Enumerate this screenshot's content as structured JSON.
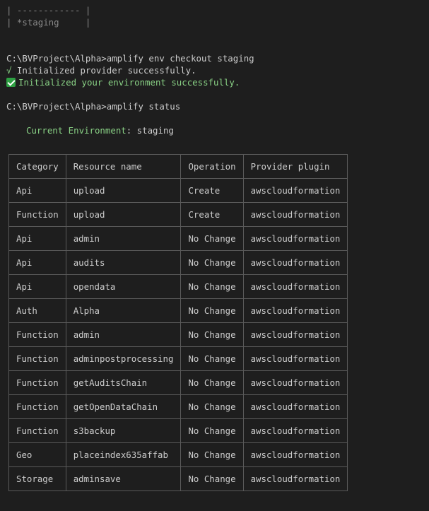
{
  "terminal": {
    "env_list_separator": "| ------------ |",
    "env_list_current": "| *staging     |",
    "command_checkout": "C:\\BVProject\\Alpha>amplify env checkout staging",
    "provider_check": "√",
    "provider_msg": " Initialized provider successfully.",
    "env_msg": "Initialized your environment successfully.",
    "command_status": "C:\\BVProject\\Alpha>amplify status",
    "current_env_label": "Current Environment",
    "current_env_value": ": staging"
  },
  "status_table": {
    "headers": [
      "Category",
      "Resource name",
      "Operation",
      "Provider plugin"
    ],
    "rows": [
      [
        "Api",
        "upload",
        "Create",
        "awscloudformation"
      ],
      [
        "Function",
        "upload",
        "Create",
        "awscloudformation"
      ],
      [
        "Api",
        "admin",
        "No Change",
        "awscloudformation"
      ],
      [
        "Api",
        "audits",
        "No Change",
        "awscloudformation"
      ],
      [
        "Api",
        "opendata",
        "No Change",
        "awscloudformation"
      ],
      [
        "Auth",
        "Alpha",
        "No Change",
        "awscloudformation"
      ],
      [
        "Function",
        "admin",
        "No Change",
        "awscloudformation"
      ],
      [
        "Function",
        "adminpostprocessing",
        "No Change",
        "awscloudformation"
      ],
      [
        "Function",
        "getAuditsChain",
        "No Change",
        "awscloudformation"
      ],
      [
        "Function",
        "getOpenDataChain",
        "No Change",
        "awscloudformation"
      ],
      [
        "Function",
        "s3backup",
        "No Change",
        "awscloudformation"
      ],
      [
        "Geo",
        "placeindex635affab",
        "No Change",
        "awscloudformation"
      ],
      [
        "Storage",
        "adminsave",
        "No Change",
        "awscloudformation"
      ]
    ]
  },
  "icons": {
    "provider_check": "check-mark-icon",
    "env_check": "green-check-box-icon"
  },
  "colors": {
    "background": "#1e1e1e",
    "text": "#cccccc",
    "success": "#89d185",
    "check_box": "#2ea043",
    "table_border": "#5a5a5a"
  }
}
